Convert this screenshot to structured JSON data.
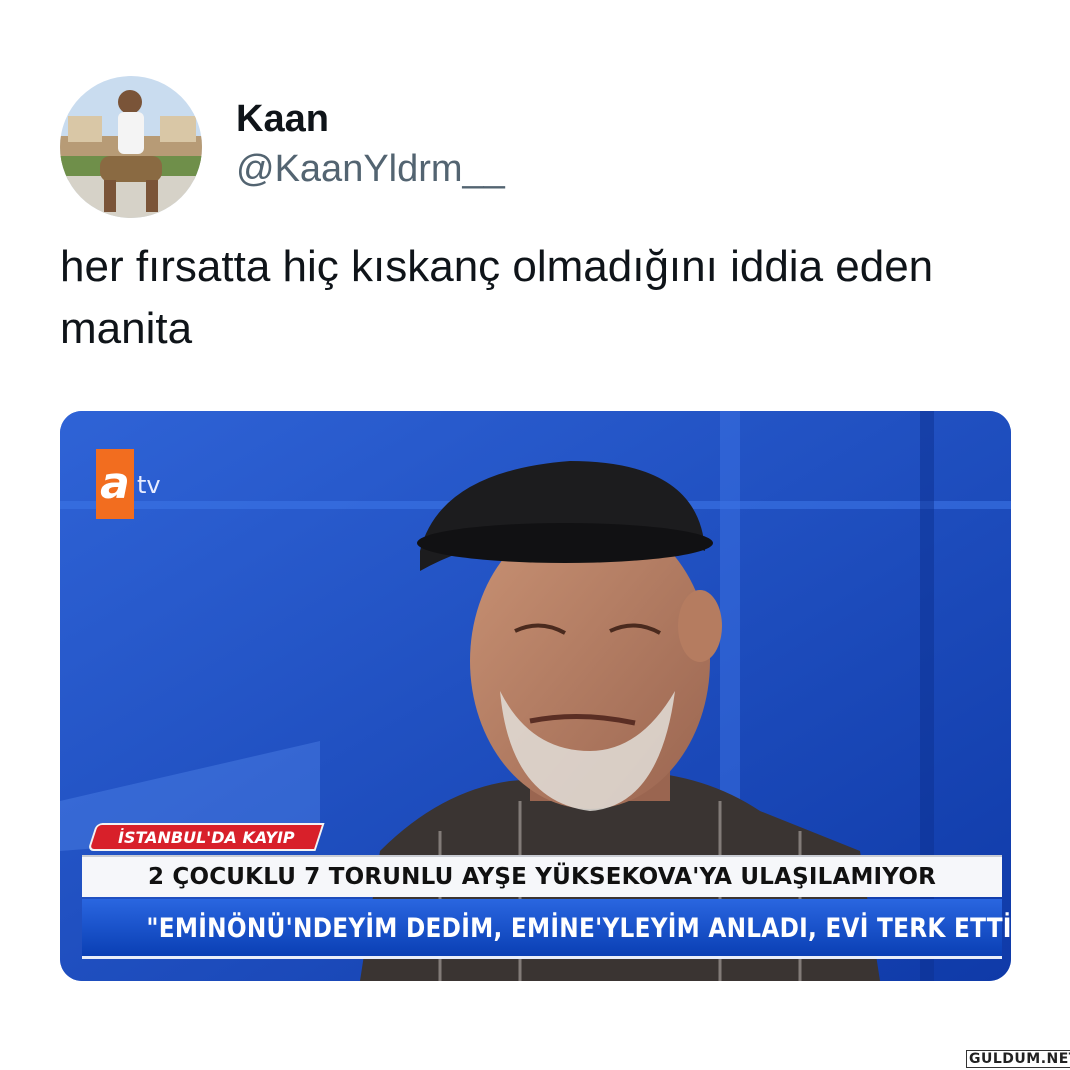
{
  "tweet": {
    "display_name": "Kaan",
    "handle": "@KaanYldrm__",
    "text": "her fırsatta hiç kıskanç olmadığını iddia eden manita"
  },
  "media": {
    "channel_logo_letter": "a",
    "channel_logo_suffix": "tv",
    "location_tag": "İSTANBUL'DA KAYIP",
    "headline": "2 ÇOCUKLU 7 TORUNLU AYŞE YÜKSEKOVA'YA ULAŞILAMIYOR",
    "subheadline": "\"EMİNÖNÜ'NDEYİM DEDİM, EMİNE'YLEYİM ANLADI, EVİ TERK ETTİ\"",
    "colors": {
      "studio_blue": "#1a4ec8",
      "logo_orange": "#f26d1f",
      "tag_red": "#d8202a"
    }
  },
  "watermark": "GULDUM.NET"
}
